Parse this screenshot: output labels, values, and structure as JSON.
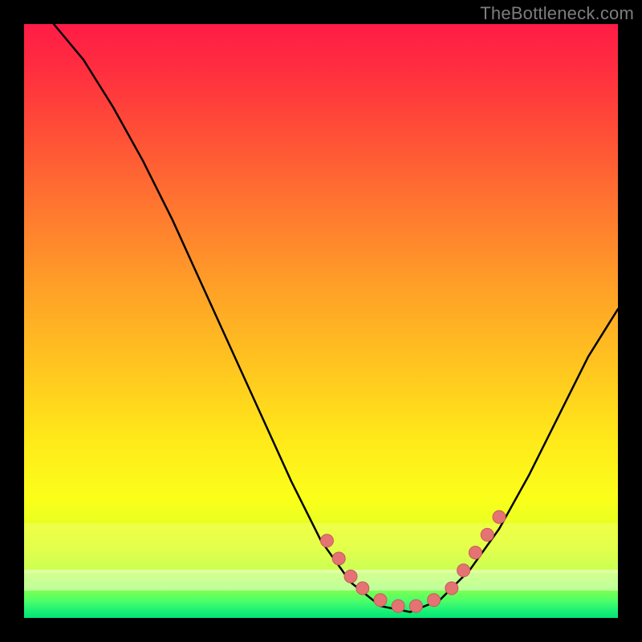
{
  "watermark": "TheBottleneck.com",
  "colors": {
    "curve": "#000000",
    "marker_fill": "#e57373",
    "marker_stroke": "#c75a5a"
  },
  "chart_data": {
    "type": "line",
    "title": "",
    "xlabel": "",
    "ylabel": "",
    "xlim": [
      0,
      100
    ],
    "ylim": [
      0,
      100
    ],
    "curve": [
      {
        "x": 5,
        "y": 100
      },
      {
        "x": 10,
        "y": 94
      },
      {
        "x": 15,
        "y": 86
      },
      {
        "x": 20,
        "y": 77
      },
      {
        "x": 25,
        "y": 67
      },
      {
        "x": 30,
        "y": 56
      },
      {
        "x": 35,
        "y": 45
      },
      {
        "x": 40,
        "y": 34
      },
      {
        "x": 45,
        "y": 23
      },
      {
        "x": 50,
        "y": 13
      },
      {
        "x": 55,
        "y": 6
      },
      {
        "x": 60,
        "y": 2
      },
      {
        "x": 65,
        "y": 1
      },
      {
        "x": 70,
        "y": 3
      },
      {
        "x": 75,
        "y": 8
      },
      {
        "x": 80,
        "y": 15
      },
      {
        "x": 85,
        "y": 24
      },
      {
        "x": 90,
        "y": 34
      },
      {
        "x": 95,
        "y": 44
      },
      {
        "x": 100,
        "y": 52
      }
    ],
    "markers": [
      {
        "x": 51,
        "y": 13
      },
      {
        "x": 53,
        "y": 10
      },
      {
        "x": 55,
        "y": 7
      },
      {
        "x": 57,
        "y": 5
      },
      {
        "x": 60,
        "y": 3
      },
      {
        "x": 63,
        "y": 2
      },
      {
        "x": 66,
        "y": 2
      },
      {
        "x": 69,
        "y": 3
      },
      {
        "x": 72,
        "y": 5
      },
      {
        "x": 74,
        "y": 8
      },
      {
        "x": 76,
        "y": 11
      },
      {
        "x": 78,
        "y": 14
      },
      {
        "x": 80,
        "y": 17
      }
    ]
  }
}
